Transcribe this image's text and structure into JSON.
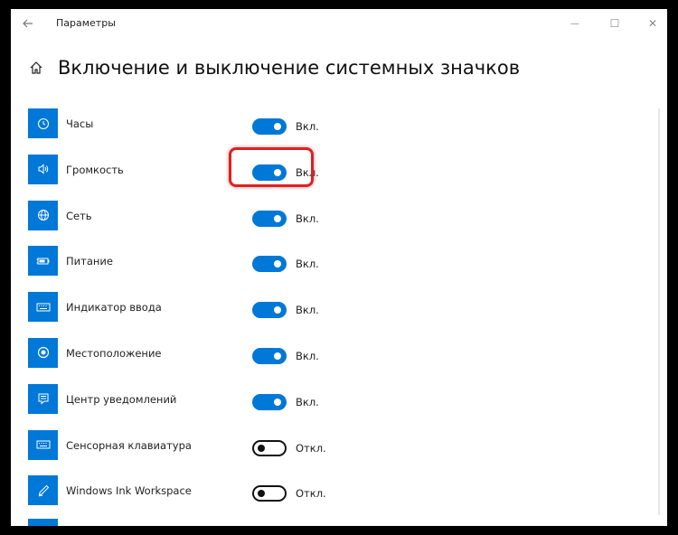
{
  "window": {
    "title": "Параметры",
    "back_icon": "arrow-left-icon",
    "minimize_glyph": "—",
    "maximize_glyph": "☐",
    "close_glyph": "✕"
  },
  "header": {
    "home_icon": "home-icon",
    "title": "Включение и выключение системных значков"
  },
  "colors": {
    "accent": "#0078d7",
    "highlight": "#e02020"
  },
  "items": [
    {
      "label": "Часы",
      "icon": "clock-icon",
      "on": true,
      "state": "Вкл."
    },
    {
      "label": "Громкость",
      "icon": "volume-icon",
      "on": true,
      "state": "Вкл."
    },
    {
      "label": "Сеть",
      "icon": "globe-icon",
      "on": true,
      "state": "Вкл."
    },
    {
      "label": "Питание",
      "icon": "battery-icon",
      "on": true,
      "state": "Вкл."
    },
    {
      "label": "Индикатор ввода",
      "icon": "keyboard-icon",
      "on": true,
      "state": "Вкл."
    },
    {
      "label": "Местоположение",
      "icon": "location-icon",
      "on": true,
      "state": "Вкл."
    },
    {
      "label": "Центр уведомлений",
      "icon": "notification-icon",
      "on": true,
      "state": "Вкл."
    },
    {
      "label": "Сенсорная клавиатура",
      "icon": "touch-keyboard-icon",
      "on": false,
      "state": "Откл."
    },
    {
      "label": "Windows Ink Workspace",
      "icon": "pen-icon",
      "on": false,
      "state": "Откл."
    }
  ]
}
